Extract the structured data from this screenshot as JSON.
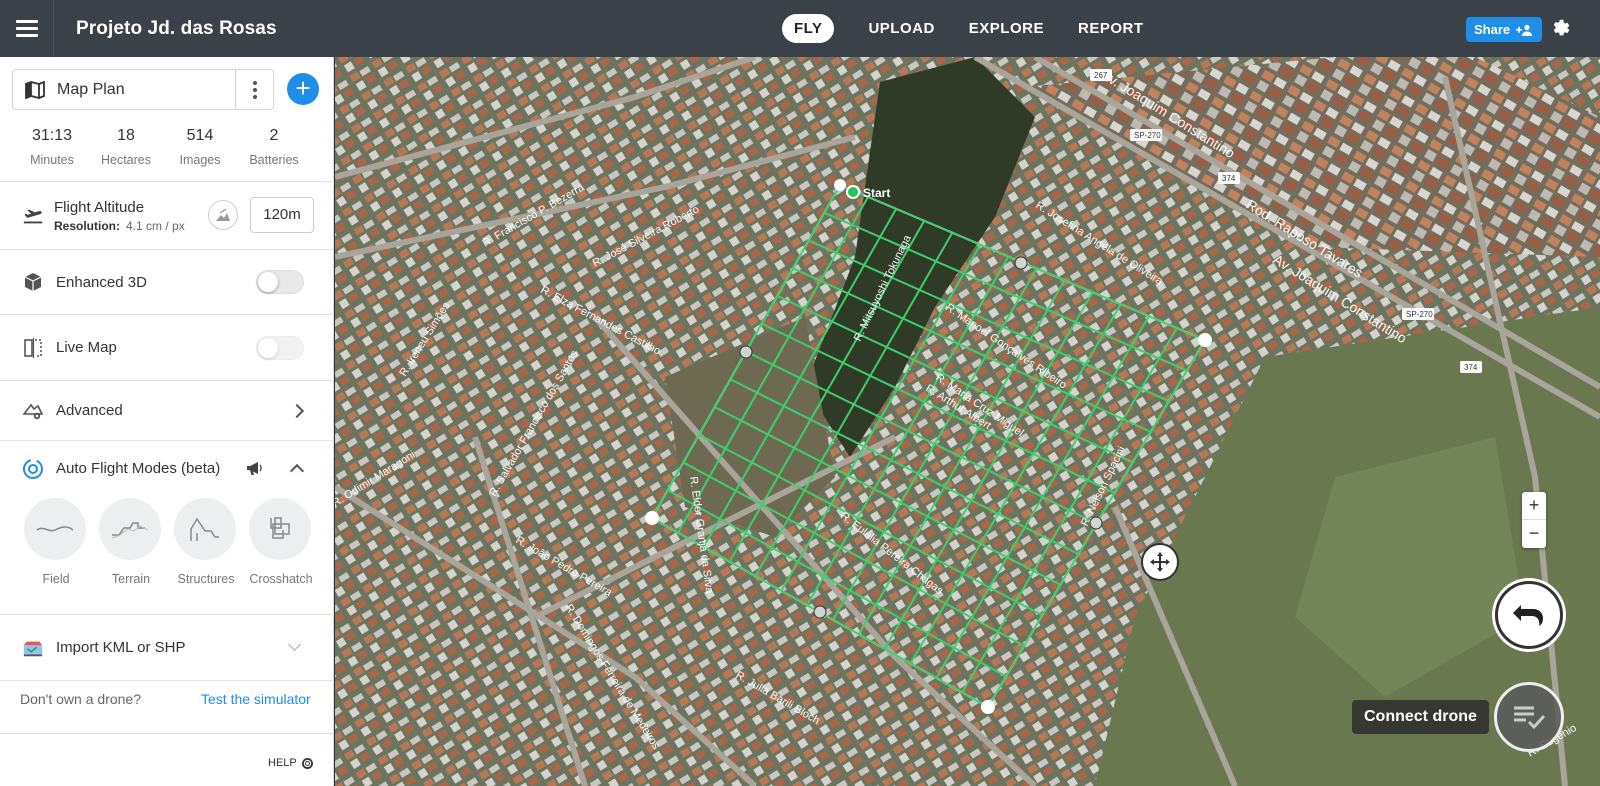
{
  "header": {
    "project_title": "Projeto Jd. das Rosas",
    "tabs": [
      {
        "label": "FLY",
        "active": true
      },
      {
        "label": "UPLOAD",
        "active": false
      },
      {
        "label": "EXPLORE",
        "active": false
      },
      {
        "label": "REPORT",
        "active": false
      }
    ],
    "share_label": "Share"
  },
  "plan": {
    "name": "Map Plan",
    "stats": [
      {
        "value": "31:13",
        "label": "Minutes"
      },
      {
        "value": "18",
        "label": "Hectares"
      },
      {
        "value": "514",
        "label": "Images"
      },
      {
        "value": "2",
        "label": "Batteries"
      }
    ]
  },
  "altitude": {
    "title": "Flight Altitude",
    "resolution_label": "Resolution:",
    "resolution_value": "4.1 cm / px",
    "value": "120m"
  },
  "settings": {
    "enhanced_3d": {
      "label": "Enhanced 3D",
      "on": false
    },
    "live_map": {
      "label": "Live Map",
      "on": false
    },
    "advanced": "Advanced",
    "auto_flight": "Auto Flight Modes (beta)",
    "modes": [
      {
        "label": "Field",
        "icon": "field-icon"
      },
      {
        "label": "Terrain",
        "icon": "terrain-icon"
      },
      {
        "label": "Structures",
        "icon": "structures-icon"
      },
      {
        "label": "Crosshatch",
        "icon": "crosshatch-icon"
      }
    ],
    "import": "Import KML or SHP"
  },
  "footer": {
    "question": "Don't own a drone?",
    "simulator_link": "Test the simulator",
    "help": "HELP"
  },
  "map": {
    "start_label": "Start",
    "connect_label": "Connect drone",
    "zoom_in": "+",
    "zoom_out": "−",
    "street_labels": [
      "R. Mitsuyoshi Tokunaga",
      "Av. Joaquim Constantino",
      "Rod. Raposo Tavares",
      "Av. Joaquim Constantino",
      "R. Josefina Angela de Oliveira",
      "R. Francisco P. Bezerra",
      "R. Elza Fernandes Castilho",
      "R. Nelson Spacini",
      "R. Domingos Ferreira de Medeiros",
      "R. Julia Barili Bloch",
      "R. João Pedro Pereira",
      "R. Salvador Francisco dos Santos",
      "R. José Silveira Roberto",
      "R. Arthur Albert",
      "R. Eulália Pereira Chagas",
      "R. Maria Cruz Miguel",
      "R. Manoel Gonçalves Ribeiro",
      "R. Elder Granja da Silva",
      "R. Ireneu Simões",
      "R. Odimir Maragoni",
      "R. Eugênio"
    ],
    "road_badges": [
      "267",
      "SP-270",
      "374",
      "SP-270",
      "374"
    ]
  }
}
